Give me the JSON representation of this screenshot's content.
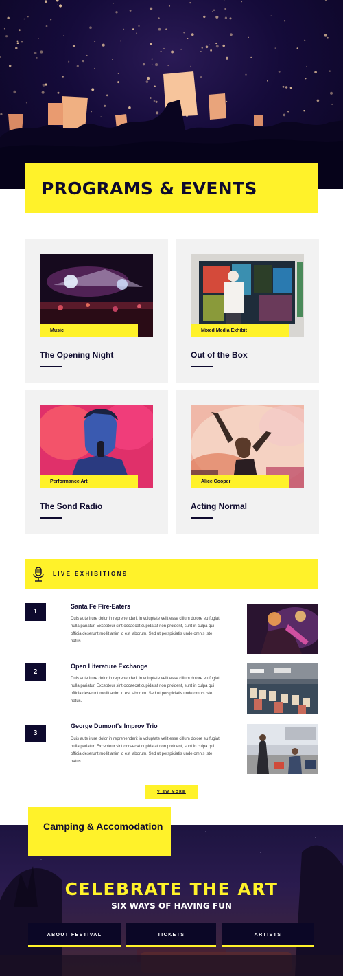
{
  "hero": {
    "title": "PROGRAMS & EVENTS"
  },
  "events": [
    {
      "tag": "Music",
      "title": "The Opening Night"
    },
    {
      "tag": "Mixed Media Exhibit",
      "title": "Out of the Box"
    },
    {
      "tag": "Performance Art",
      "title": "The Sond Radio"
    },
    {
      "tag": "Alice Cooper",
      "title": "Acting Normal"
    }
  ],
  "live": {
    "heading": "LIVE EXHIBITIONS",
    "icon": "microphone-icon",
    "items": [
      {
        "number": "1",
        "title": "Santa Fe Fire-Eaters",
        "body": "Duis aute irure dolor in reprehenderit in voluptate velit esse cillum dolore eu fugiat nulla pariatur. Excepteur sint occaecat cupidatat non proident, sunt in culpa qui officia deserunt mollit anim id est laborum. Sed ut perspiciatis unde omnis iste natus."
      },
      {
        "number": "2",
        "title": "Open Literature Exchange",
        "body": "Duis aute irure dolor in reprehenderit in voluptate velit esse cillum dolore eu fugiat nulla pariatur. Excepteur sint occaecat cupidatat non proident, sunt in culpa qui officia deserunt mollit anim id est laborum. Sed ut perspiciatis unde omnis iste natus."
      },
      {
        "number": "3",
        "title": "George Dumont's Improv Trio",
        "body": "Duis aute irure dolor in reprehenderit in voluptate velit esse cillum dolore eu fugiat nulla pariatur. Excepteur sint occaecat cupidatat non proident, sunt in culpa qui officia deserunt mollit anim id est laborum. Sed ut perspiciatis unde omnis iste natus."
      }
    ],
    "view_more": "VIEW MORE"
  },
  "footer": {
    "camping": "Camping & Accomodation",
    "headline": "CELEBRATE THE ART",
    "subheadline": "SIX WAYS OF HAVING FUN",
    "nav": [
      "ABOUT FESTIVAL",
      "TICKETS",
      "ARTISTS"
    ]
  },
  "colors": {
    "accent": "#fff22a",
    "navy": "#0e0a2e",
    "card_bg": "#f2f2f2"
  }
}
